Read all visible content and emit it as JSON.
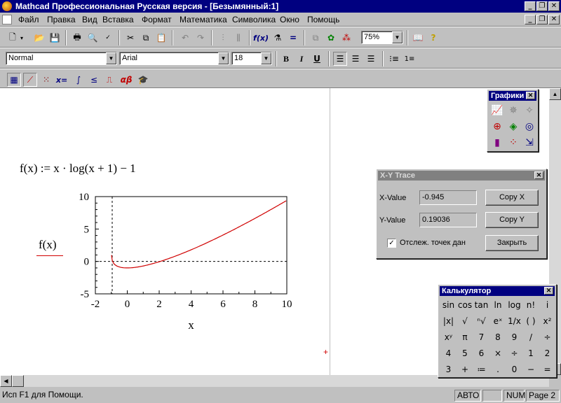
{
  "window": {
    "title": "Mathcad Профессиональная Русская версия - [Безымянный:1]"
  },
  "menu": [
    "Файл",
    "Правка",
    "Вид",
    "Вставка",
    "Формат",
    "Математика",
    "Символика",
    "Окно",
    "Помощь"
  ],
  "format_bar": {
    "style": "Normal",
    "font": "Arial",
    "size": "18",
    "bold": "B",
    "italic": "I",
    "underline": "U"
  },
  "standard_bar": {
    "zoom": "75%"
  },
  "math_bar": {
    "eval_label": "x=",
    "greek_label": "αβ"
  },
  "document": {
    "definition": "f(x) := x · log(x + 1) − 1",
    "y_axis_label": "f(x)",
    "x_axis_label": "x"
  },
  "chart_data": {
    "type": "line",
    "function": "f(x) = x·log(x+1) − 1",
    "xlim": [
      -2,
      10
    ],
    "ylim": [
      -5,
      10
    ],
    "x_ticks": [
      "-2",
      "0",
      "2",
      "4",
      "6",
      "8",
      "10"
    ],
    "y_ticks": [
      "10",
      "5",
      "0",
      "-5"
    ],
    "xlabel": "x",
    "ylabel": "f(x)",
    "marker_x": -0.945,
    "line_color": "#d00000",
    "grid": false
  },
  "graphs_palette": {
    "title": "Графики"
  },
  "trace_dialog": {
    "title": "X-Y Trace",
    "x_label": "X-Value",
    "x_value": "-0.945",
    "y_label": "Y-Value",
    "y_value": "0.19036",
    "copy_x": "Copy X",
    "copy_y": "Copy Y",
    "track_label": "Отслеж. точек дан",
    "close": "Закрыть"
  },
  "calculator": {
    "title": "Калькулятор",
    "rows": [
      [
        "sin",
        "cos",
        "tan",
        "ln",
        "log",
        "n!",
        "i"
      ],
      [
        "|x|",
        "√",
        "ⁿ√",
        "eˣ",
        "1/x",
        "( )",
        "x²"
      ],
      [
        "xʸ",
        "π",
        "7",
        "8",
        "9",
        "/",
        "÷"
      ],
      [
        "4",
        "5",
        "6",
        "×",
        "÷",
        "1",
        "2"
      ],
      [
        "3",
        "+",
        "≔",
        ".",
        "0",
        "−",
        "="
      ]
    ]
  },
  "status": {
    "help": "Исп F1 для Помощи.",
    "mode": "АВТО",
    "num": "NUM",
    "page": "Page 2"
  },
  "colors": {
    "titlebar": "#000080",
    "curve": "#d00000"
  }
}
